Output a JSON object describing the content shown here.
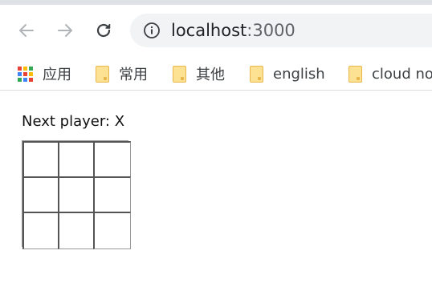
{
  "browser": {
    "address_host": "localhost",
    "address_port": ":3000",
    "bookmarks": [
      "应用",
      "常用",
      "其他",
      "english",
      "cloud no"
    ]
  },
  "icons": {
    "back": "arrow-left-icon",
    "forward": "arrow-right-icon",
    "reload": "reload-icon",
    "info": "info-icon",
    "apps": "apps-grid-icon",
    "folder": "folder-icon"
  },
  "colors": {
    "toolbar_bg": "#ffffff",
    "omnibox_bg": "#f1f3f4",
    "folder": "#fde293",
    "board_border": "#999999"
  },
  "game": {
    "status": "Next player: X",
    "squares": [
      "",
      "",
      "",
      "",
      "",
      "",
      "",
      "",
      ""
    ]
  }
}
